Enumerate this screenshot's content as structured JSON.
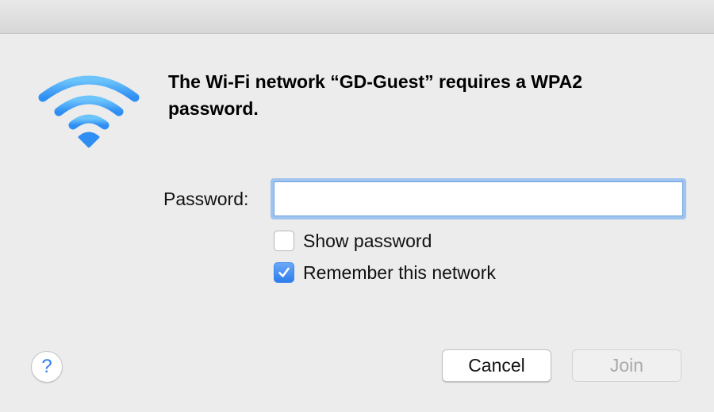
{
  "dialog": {
    "message": "The Wi-Fi network “GD-Guest” requires a WPA2 password.",
    "icon": "wifi-icon",
    "accent_color": "#2f7deb"
  },
  "form": {
    "password_label": "Password:",
    "password_value": "",
    "show_password_label": "Show password",
    "show_password_checked": false,
    "remember_label": "Remember this network",
    "remember_checked": true
  },
  "buttons": {
    "help_label": "?",
    "cancel_label": "Cancel",
    "join_label": "Join",
    "join_enabled": false
  }
}
